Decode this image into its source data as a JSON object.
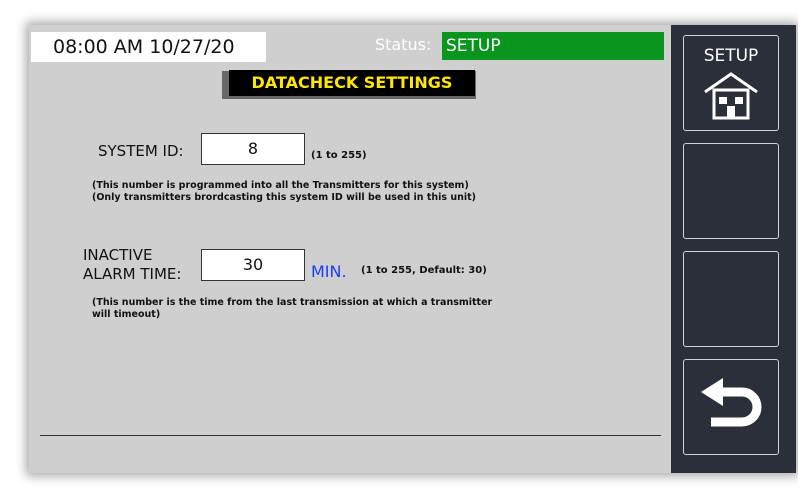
{
  "header": {
    "datetime": "08:00 AM 10/27/20",
    "status_label": "Status:",
    "status_value": "SETUP"
  },
  "title": "DATACHECK SETTINGS",
  "system_id": {
    "label": "SYSTEM ID:",
    "value": "8",
    "range_hint": "(1 to 255)",
    "note_line1": "(This number is programmed into all the Transmitters for this system)",
    "note_line2": "(Only transmitters brordcasting this system ID will be used in this unit)"
  },
  "inactive_alarm": {
    "label_line1": "INACTIVE",
    "label_line2": "ALARM TIME:",
    "value": "30",
    "unit": "MIN.",
    "range_hint": "(1 to 255, Default: 30)",
    "note_line1": "(This number is the time from the last transmission at which a transmitter",
    "note_line2": "will timeout)"
  },
  "sidebar": {
    "setup_label": "SETUP",
    "icons": [
      "home-icon",
      "back-arrow-icon"
    ]
  },
  "colors": {
    "status_green": "#08961e",
    "title_yellow": "#ffe600",
    "unit_blue": "#1a3cff",
    "sidebar_bg": "#2b2f39"
  }
}
